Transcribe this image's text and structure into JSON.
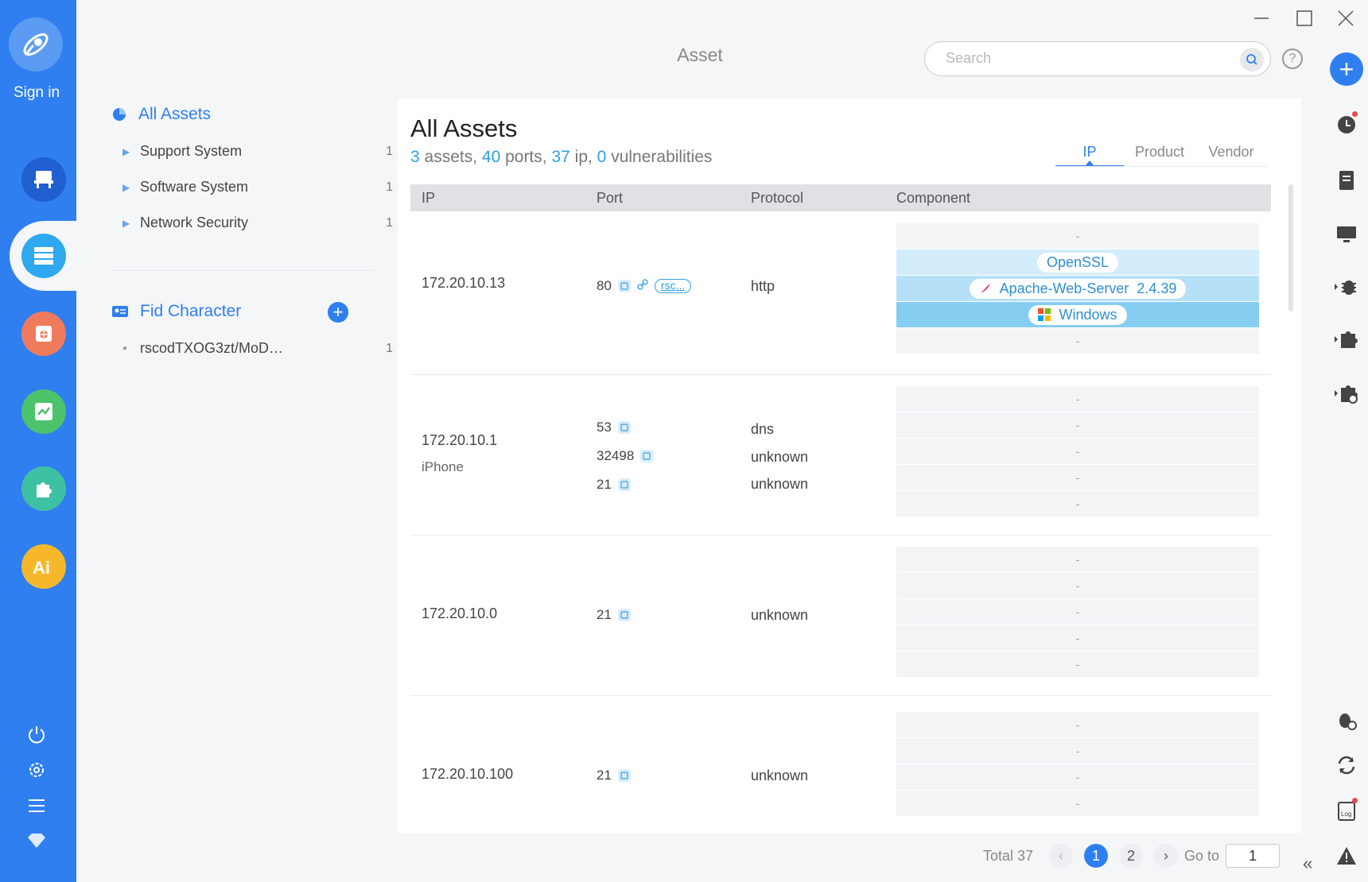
{
  "window": {
    "title": "Asset"
  },
  "rail": {
    "signin_label": "Sign in",
    "icons": [
      "desk-icon",
      "server-icon",
      "bug-icon",
      "chart-icon",
      "puzzle-icon",
      "ai-icon"
    ],
    "bottom_icons": [
      "power-icon",
      "settings-icon",
      "menu-icon",
      "diamond-icon"
    ]
  },
  "sidebar": {
    "all_assets_label": "All Assets",
    "items": [
      {
        "label": "Support System",
        "count": "1"
      },
      {
        "label": "Software System",
        "count": "1"
      },
      {
        "label": "Network Security",
        "count": "1"
      }
    ],
    "fid_label": "Fid Character",
    "fid_items": [
      {
        "label": "rscodTXOG3zt/MoD…",
        "count": "1"
      }
    ]
  },
  "search": {
    "placeholder": "Search"
  },
  "main": {
    "title": "All Assets",
    "stats": {
      "assets": "3",
      "assets_label": " assets, ",
      "ports": "40",
      "ports_label": " ports, ",
      "ip": "37",
      "ip_label": " ip, ",
      "vulns": "0",
      "vulns_label": " vulnerabilities"
    },
    "tabs": [
      "IP",
      "Product",
      "Vendor"
    ],
    "active_tab": "IP",
    "columns": [
      "IP",
      "Port",
      "Protocol",
      "Component"
    ],
    "rows": [
      {
        "ip": "172.20.10.13",
        "sub": "",
        "ports": [
          {
            "port": "80",
            "protocol": "http",
            "tag": "rsc..."
          }
        ],
        "components": [
          "-",
          "OpenSSL",
          "Apache-Web-Server",
          "Windows",
          "-"
        ],
        "apache_version": "2.4.39"
      },
      {
        "ip": "172.20.10.1",
        "sub": "iPhone",
        "ports": [
          {
            "port": "53",
            "protocol": "dns"
          },
          {
            "port": "32498",
            "protocol": "unknown"
          },
          {
            "port": "21",
            "protocol": "unknown"
          }
        ],
        "components": [
          "-",
          "-",
          "-",
          "-",
          "-"
        ]
      },
      {
        "ip": "172.20.10.0",
        "sub": "",
        "ports": [
          {
            "port": "21",
            "protocol": "unknown"
          }
        ],
        "components": [
          "-",
          "-",
          "-",
          "-",
          "-"
        ]
      },
      {
        "ip": "172.20.10.100",
        "sub": "",
        "ports": [
          {
            "port": "21",
            "protocol": "unknown"
          }
        ],
        "components": [
          "-",
          "-",
          "-",
          "-"
        ]
      }
    ]
  },
  "pagination": {
    "total_label": "Total 37",
    "pages": [
      "1",
      "2"
    ],
    "current": "1",
    "goto_label": "Go to",
    "goto_value": "1"
  },
  "colors": {
    "accent": "#2f7ff0",
    "rail": "#2f7ff0",
    "stat_number": "#2f9fe0"
  }
}
